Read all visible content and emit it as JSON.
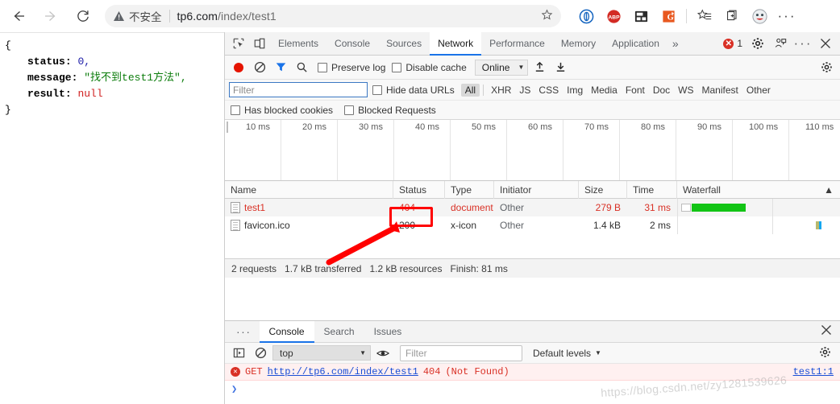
{
  "browser": {
    "back_icon": "arrow-left-icon",
    "forward_icon": "arrow-right-icon",
    "reload_icon": "reload-icon",
    "security_label": "不安全",
    "url_host": "tp6.com",
    "url_path": "/index/test1",
    "bookmark_icon": "star-icon",
    "extensions": [
      "browser-shield-icon",
      "abp-icon",
      "screenshot-icon",
      "translate-icon"
    ],
    "collections_icon": "collections-icon",
    "favorites_icon": "favorites-icon",
    "profile_icon": "profile-avatar-icon",
    "more_icon": "more-horizontal-icon"
  },
  "page": {
    "brace_open": "{",
    "brace_close": "}",
    "lines": [
      {
        "key": "status",
        "colon": ":",
        "value": "0,",
        "type": "num"
      },
      {
        "key": "message",
        "colon": ":",
        "value": "\"找不到test1方法\",",
        "type": "str"
      },
      {
        "key": "result",
        "colon": ":",
        "value": "null",
        "type": "null"
      }
    ]
  },
  "devtools": {
    "inspect_icon": "inspect-element-icon",
    "device_icon": "device-toolbar-icon",
    "tabs": [
      {
        "label": "Elements",
        "active": false
      },
      {
        "label": "Console",
        "active": false
      },
      {
        "label": "Sources",
        "active": false
      },
      {
        "label": "Network",
        "active": true
      },
      {
        "label": "Performance",
        "active": false
      },
      {
        "label": "Memory",
        "active": false
      },
      {
        "label": "Application",
        "active": false
      }
    ],
    "overflow_icon": "chevron-double-right-icon",
    "error_count": "1",
    "settings_icon": "gear-icon",
    "feedback_icon": "feedback-person-icon",
    "more_icon": "more-horizontal-icon",
    "close_icon": "close-icon"
  },
  "network_toolbar": {
    "record_icon": "record-stop-icon",
    "clear_icon": "clear-icon",
    "filter_icon": "filter-funnel-icon",
    "search_icon": "search-icon",
    "preserve_log": "Preserve log",
    "disable_cache": "Disable cache",
    "throttling": "Online",
    "import_icon": "import-har-icon",
    "export_icon": "export-har-icon",
    "settings_icon": "gear-icon"
  },
  "filter_bar": {
    "placeholder": "Filter",
    "value": "",
    "hide_data_urls": "Hide data URLs",
    "types": [
      "All",
      "XHR",
      "JS",
      "CSS",
      "Img",
      "Media",
      "Font",
      "Doc",
      "WS",
      "Manifest",
      "Other"
    ],
    "active_type": "All",
    "has_blocked_cookies": "Has blocked cookies",
    "blocked_requests": "Blocked Requests"
  },
  "overview": {
    "ticks": [
      "10 ms",
      "20 ms",
      "30 ms",
      "40 ms",
      "50 ms",
      "60 ms",
      "70 ms",
      "80 ms",
      "90 ms",
      "100 ms",
      "110 ms"
    ]
  },
  "requests_table": {
    "columns": [
      "Name",
      "Status",
      "Type",
      "Initiator",
      "Size",
      "Time",
      "Waterfall"
    ],
    "sort_icon": "sort-ascending-icon",
    "rows": [
      {
        "icon": "document-file-icon",
        "name": "test1",
        "status": "404",
        "type": "document",
        "initiator": "Other",
        "size": "279 B",
        "time": "31 ms",
        "error": true
      },
      {
        "icon": "generic-file-icon",
        "name": "favicon.ico",
        "status": "200",
        "type": "x-icon",
        "initiator": "Other",
        "size": "1.4 kB",
        "time": "2 ms",
        "error": false
      }
    ]
  },
  "summary": {
    "requests": "2 requests",
    "transferred": "1.7 kB transferred",
    "resources": "1.2 kB resources",
    "finish": "Finish: 81 ms"
  },
  "drawer": {
    "more_icon": "more-horizontal-icon",
    "tabs": [
      {
        "label": "Console",
        "active": true
      },
      {
        "label": "Search",
        "active": false
      },
      {
        "label": "Issues",
        "active": false
      }
    ],
    "close_icon": "close-icon"
  },
  "console_toolbar": {
    "sidebar_icon": "console-sidebar-icon",
    "clear_icon": "clear-console-icon",
    "context": "top",
    "eye_icon": "live-expression-eye-icon",
    "filter_placeholder": "Filter",
    "filter_value": "",
    "levels": "Default levels",
    "settings_icon": "gear-icon"
  },
  "console_message": {
    "error_icon": "error-circle-icon",
    "method": "GET",
    "url": "http://tp6.com/index/test1",
    "status": "404",
    "reason": "(Not Found)",
    "source": "test1:1",
    "prompt": "❯"
  },
  "annotations": {
    "highlight_target": "404",
    "arrow": "red-arrow-pointing-to-404"
  },
  "watermark": "https://blog.csdn.net/zy1281539626"
}
